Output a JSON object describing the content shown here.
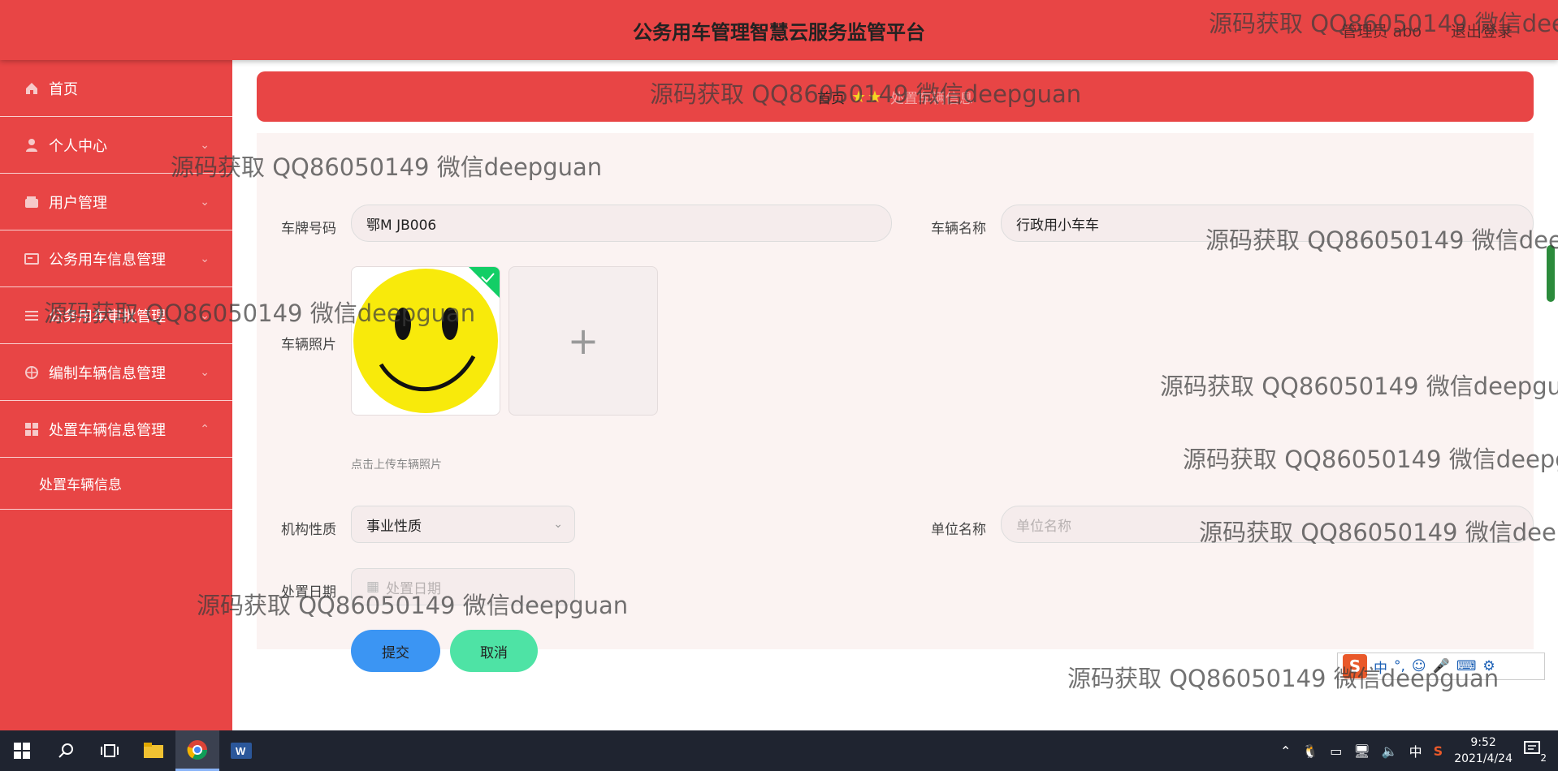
{
  "header": {
    "title": "公务用车管理智慧云服务监管平台",
    "user": "管理员 abo",
    "logout": "退出登录"
  },
  "sidebar": {
    "items": [
      {
        "label": "首页",
        "icon": "home-icon"
      },
      {
        "label": "个人中心",
        "icon": "user-icon"
      },
      {
        "label": "用户管理",
        "icon": "wallet-icon"
      },
      {
        "label": "公务用车信息管理",
        "icon": "card-icon"
      },
      {
        "label": "公务用车审批管理",
        "icon": "list-icon"
      },
      {
        "label": "编制车辆信息管理",
        "icon": "compass-icon"
      },
      {
        "label": "处置车辆信息管理",
        "icon": "grid-icon"
      }
    ],
    "subitem": "处置车辆信息"
  },
  "breadcrumb": {
    "home": "首页",
    "current": "处置车辆信息"
  },
  "form": {
    "plate_label": "车牌号码",
    "plate_value": "鄂M JB006",
    "name_label": "车辆名称",
    "name_value": "行政用小车车",
    "photo_label": "车辆照片",
    "photo_hint": "点击上传车辆照片",
    "org_label": "机构性质",
    "org_value": "事业性质",
    "unit_label": "单位名称",
    "unit_placeholder": "单位名称",
    "date_label": "处置日期",
    "date_placeholder": "处置日期",
    "submit": "提交",
    "cancel": "取消"
  },
  "ime": {
    "mode": "中",
    "punct": "°,"
  },
  "watermark": "源码获取 QQ86050149 微信deepguan",
  "taskbar": {
    "time": "9:52",
    "date": "2021/4/24",
    "tray_lang": "中",
    "notif_count": "2"
  },
  "colors": {
    "primary": "#e84545",
    "submit": "#3b95f3",
    "cancel": "#4ee3a5",
    "form_bg": "#fbf3f2"
  }
}
